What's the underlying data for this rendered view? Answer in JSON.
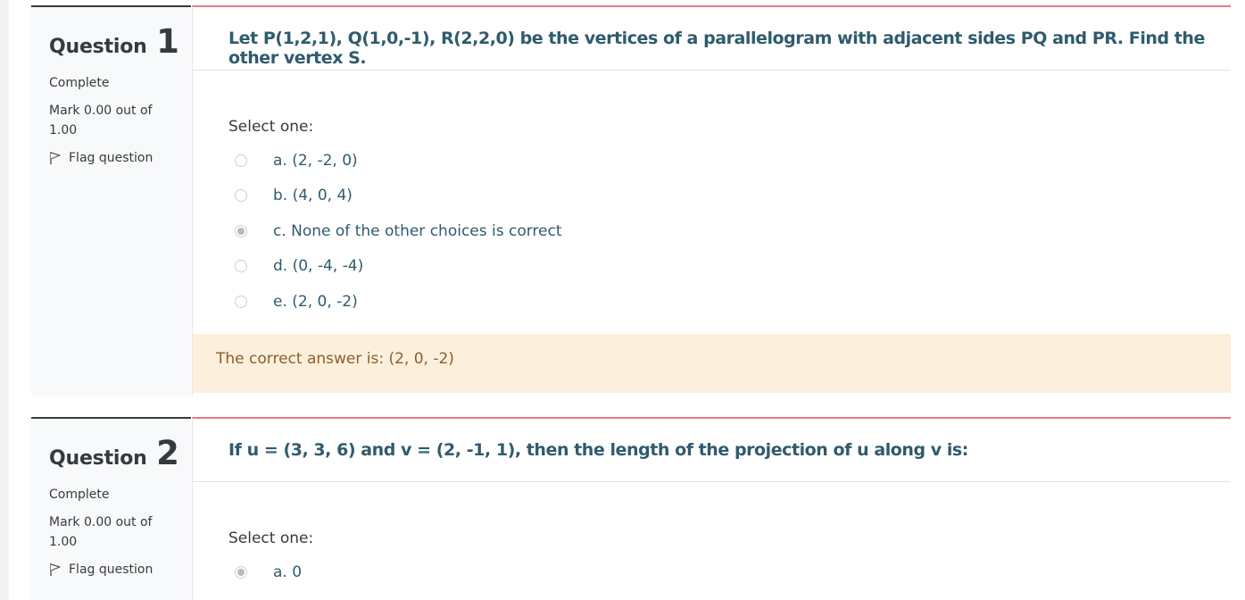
{
  "questions": [
    {
      "label": "Question",
      "number": "1",
      "state": "Complete",
      "grade": "Mark 0.00 out of 1.00",
      "flag_label": "Flag question",
      "text": "Let P(1,2,1), Q(1,0,-1), R(2,2,0) be the vertices of a parallelogram with adjacent sides PQ and PR. Find the other vertex S.",
      "prompt": "Select one:",
      "answers": [
        {
          "label": "a. (2, -2, 0)",
          "checked": false
        },
        {
          "label": "b. (4, 0, 4)",
          "checked": false
        },
        {
          "label": "c. None of the other choices is correct",
          "checked": true
        },
        {
          "label": "d. (0, -4, -4)",
          "checked": false
        },
        {
          "label": "e. (2, 0, -2)",
          "checked": false
        }
      ],
      "feedback": "The correct answer is: (2, 0, -2)"
    },
    {
      "label": "Question",
      "number": "2",
      "state": "Complete",
      "grade": "Mark 0.00 out of 1.00",
      "flag_label": "Flag question",
      "text": "If u = (3, 3, 6) and v = (2, -1, 1), then the length of the projection of u along v is:",
      "prompt": "Select one:",
      "answers": [
        {
          "label": "a. 0",
          "checked": true
        }
      ]
    }
  ],
  "colors": {
    "question_text": "#2f5b6d",
    "content_border_top": "#e57989",
    "info_border_top": "#373a3c",
    "feedback_bg": "#fcefdc",
    "feedback_text": "#8a5f2f"
  },
  "icons": {
    "flag": "flag-icon",
    "radio": "radio-button"
  }
}
